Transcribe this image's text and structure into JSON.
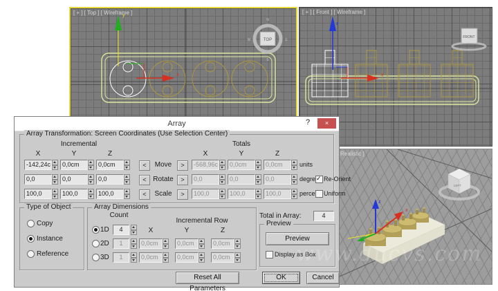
{
  "watermark": "www.ducvs.com",
  "viewports": {
    "top": {
      "label": "[ + ] [ Top ] [ Wireframe ]",
      "viewcube": "TOP",
      "compass": {
        "n": "N",
        "e": "E",
        "s": "S",
        "w": "W"
      },
      "axis_x": "x",
      "axis_y": "y"
    },
    "front": {
      "label": "[ + ] [ Front ] [ Wireframe ]",
      "viewcube": "FRONT",
      "axis_x": "x",
      "axis_z": "z"
    },
    "perspective": {
      "label_visible": "Realistic ]",
      "viewcube": "LEFT",
      "axis_x": "x",
      "axis_z": "z"
    }
  },
  "dialog": {
    "title": "Array",
    "help": "?",
    "close": "×",
    "transform": {
      "legend": "Array Transformation: Screen Coordinates (Use Selection Center)",
      "incremental_header": "Incremental",
      "totals_header": "Totals",
      "col_x": "X",
      "col_y": "Y",
      "col_z": "Z",
      "left_arrow": "<",
      "right_arrow": ">",
      "rows": [
        {
          "label": "Move",
          "inc": [
            "-142,24c",
            "0,0cm",
            "0,0cm"
          ],
          "tot": [
            "-568,96c",
            "0,0cm",
            "0,0cm"
          ],
          "unit": "units"
        },
        {
          "label": "Rotate",
          "inc": [
            "0,0",
            "0,0",
            "0,0"
          ],
          "tot": [
            "0,0",
            "0,0",
            "0,0"
          ],
          "unit": "degrees"
        },
        {
          "label": "Scale",
          "inc": [
            "100,0",
            "100,0",
            "100,0"
          ],
          "tot": [
            "100,0",
            "100,0",
            "100,0"
          ],
          "unit": "percent"
        }
      ],
      "checkboxes": [
        {
          "label": "Re-Orient",
          "checked": true
        },
        {
          "label": "Uniform",
          "checked": false
        }
      ]
    },
    "type_of_object": {
      "legend": "Type of Object",
      "options": [
        "Copy",
        "Instance",
        "Reference"
      ],
      "selected": "Instance"
    },
    "array_dimensions": {
      "legend": "Array Dimensions",
      "count_header": "Count",
      "incremental_row_header": "Incremental Row",
      "col_x": "X",
      "col_y": "Y",
      "col_z": "Z",
      "rows": [
        {
          "label": "1D",
          "count": "4",
          "selected": true,
          "fields": []
        },
        {
          "label": "2D",
          "count": "1",
          "selected": false,
          "fields": [
            "0,0cm",
            "0,0cm",
            "0,0cm"
          ]
        },
        {
          "label": "3D",
          "count": "1",
          "selected": false,
          "fields": [
            "0,0cm",
            "0,0cm",
            "0,0cm"
          ]
        }
      ]
    },
    "total_in_array": {
      "label": "Total in Array:",
      "value": "4"
    },
    "preview": {
      "legend": "Preview",
      "button": "Preview",
      "display_as_box": {
        "label": "Display as Box",
        "checked": false
      }
    },
    "buttons": {
      "reset": "Reset All Parameters",
      "ok": "OK",
      "cancel": "Cancel"
    }
  },
  "colors": {
    "active_viewport_border": "#e6d73c",
    "close_button": "#c75050",
    "selection_wire": "#ffffff",
    "object_wire": "#ad9742",
    "shape_outline": "#dcea9e",
    "axis_x": "#d83020",
    "axis_y": "#1fae1f",
    "axis_z": "#2438d8"
  }
}
